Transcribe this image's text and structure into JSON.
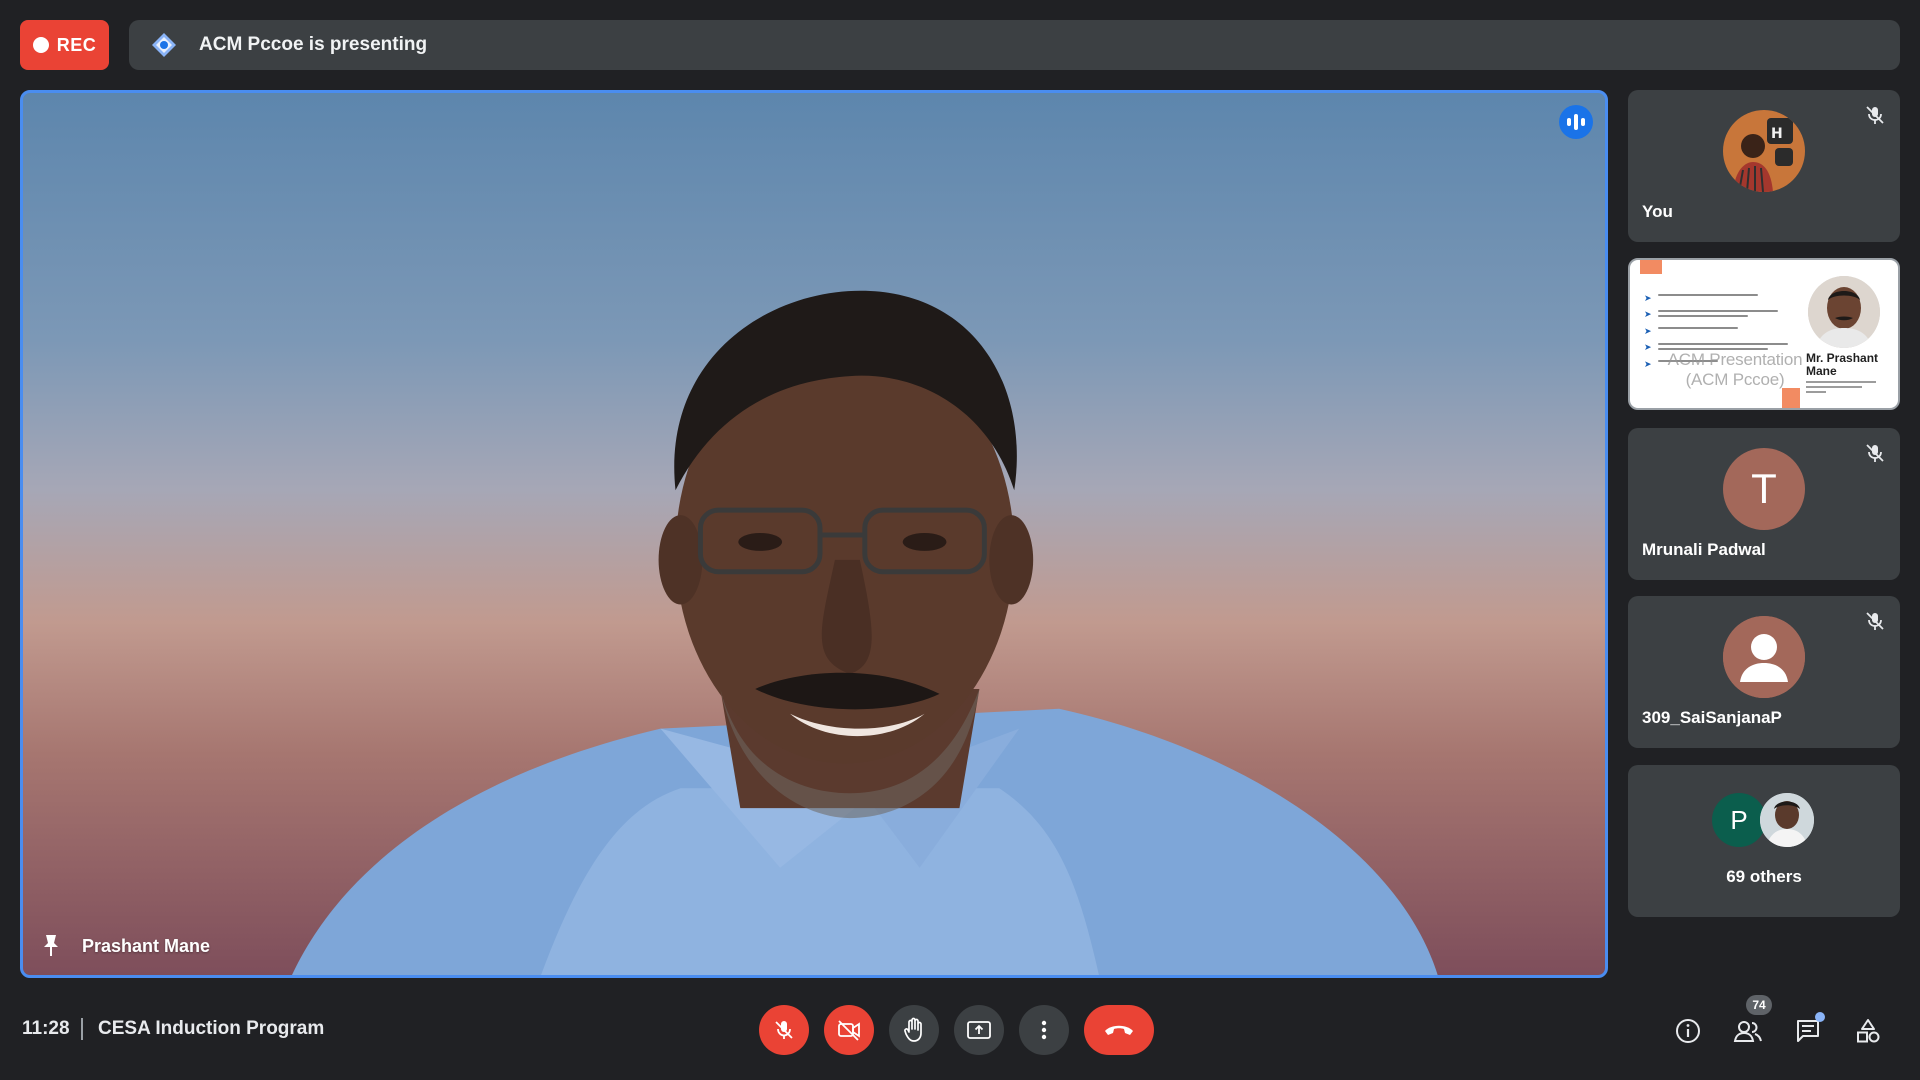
{
  "recording": {
    "label": "REC",
    "color": "#ea4335"
  },
  "presenting": {
    "text": "ACM Pccoe is presenting"
  },
  "main_tile": {
    "speaker_name": "Prashant Mane",
    "speaking": true,
    "border_color": "#4a8df0"
  },
  "participants": [
    {
      "name": "You",
      "muted": true,
      "avatar": "photo"
    },
    {
      "name": "",
      "type": "presentation",
      "slide": {
        "overlay_text": "ACM Presentation (ACM Pccoe)",
        "speaker_name": "Mr. Prashant Mane"
      }
    },
    {
      "name": "Mrunali Padwal",
      "muted": true,
      "avatar_letter": "T",
      "avatar_color": "#a3685a"
    },
    {
      "name": "309_SaiSanjanaP",
      "muted": true,
      "avatar": "generic-person-icon",
      "avatar_color": "#a3685a"
    },
    {
      "name": "69 others",
      "avatar_letter": "P",
      "avatar_color": "#0b5e4d"
    }
  ],
  "meeting": {
    "time": "11:28",
    "title": "CESA Induction Program"
  },
  "controls": [
    {
      "name": "mic-off-button",
      "icon": "mic-off-icon",
      "state": "off"
    },
    {
      "name": "camera-off-button",
      "icon": "videocam-off-icon",
      "state": "off"
    },
    {
      "name": "raise-hand-button",
      "icon": "hand-icon"
    },
    {
      "name": "present-button",
      "icon": "present-screen-icon"
    },
    {
      "name": "more-options-button",
      "icon": "more-vert-icon"
    },
    {
      "name": "leave-call-button",
      "icon": "call-end-icon"
    }
  ],
  "right_controls": {
    "people_count": "74"
  }
}
